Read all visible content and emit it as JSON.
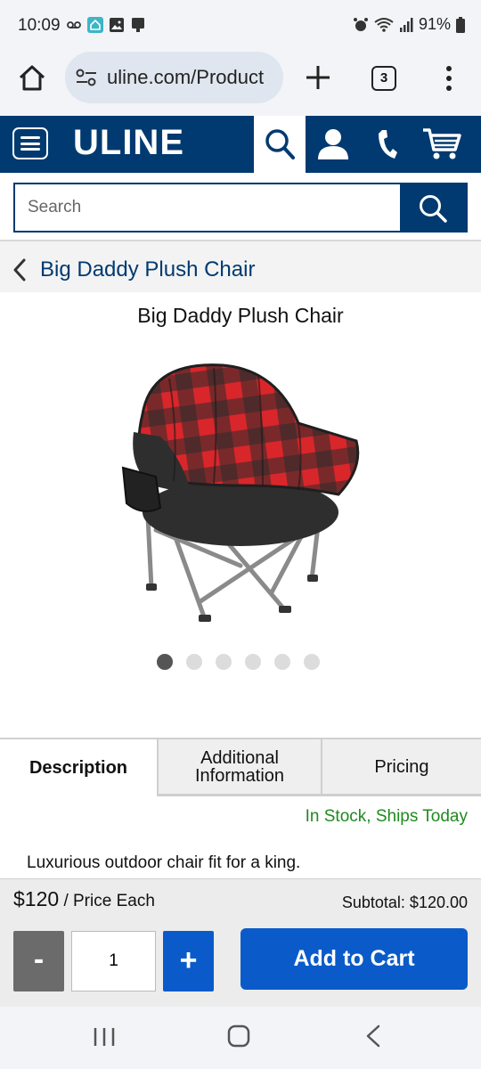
{
  "status_bar": {
    "time": "10:09",
    "battery": "91%"
  },
  "browser": {
    "url": "uline.com/Product",
    "tab_count": "3"
  },
  "header": {
    "logo": "ULINE",
    "brand_color": "#003a70"
  },
  "search": {
    "placeholder": "Search"
  },
  "breadcrumb": {
    "label": "Big Daddy Plush Chair"
  },
  "product": {
    "title": "Big Daddy Plush Chair",
    "image_count": 6,
    "active_image_index": 0
  },
  "tabs": {
    "description": "Description",
    "additional_line1": "Additional",
    "additional_line2": "Information",
    "pricing": "Pricing"
  },
  "stock_status": "In Stock, Ships Today",
  "description_text": "Luxurious outdoor chair fit for a king.",
  "purchase": {
    "price": "$120",
    "price_unit": " / Price Each",
    "subtotal": "Subtotal: $120.00",
    "quantity": "1",
    "minus_label": "-",
    "plus_label": "+",
    "add_to_cart": "Add to Cart"
  }
}
